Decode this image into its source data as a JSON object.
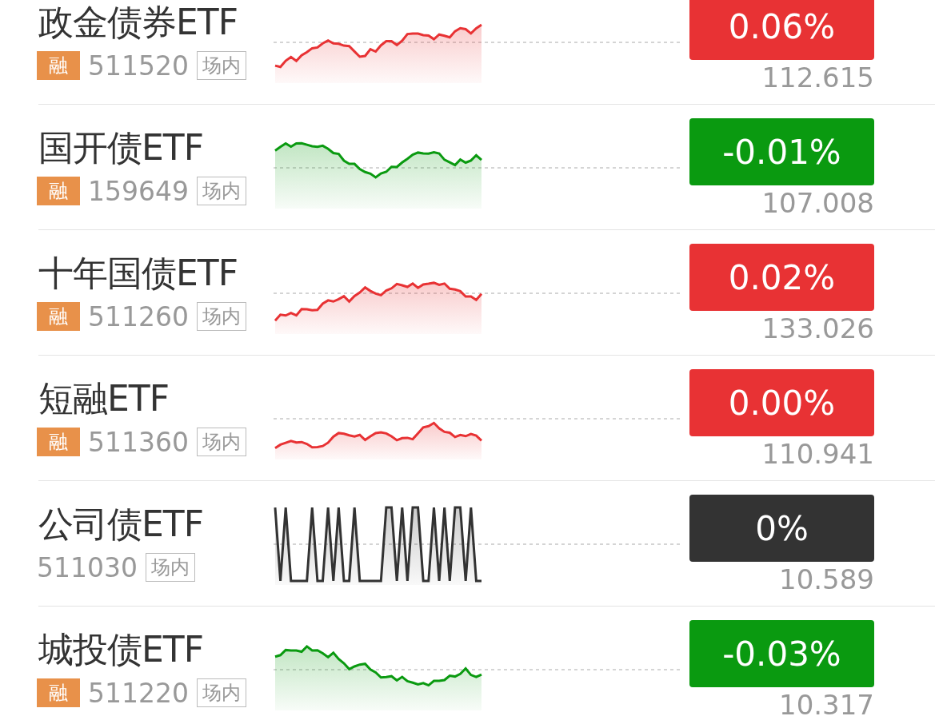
{
  "rows": [
    {
      "name": "政金债券ETF",
      "margin_tag": "融",
      "code": "511520",
      "market_tag": "场内",
      "change": "0.06%",
      "color": "#e83234",
      "price": "112.615"
    },
    {
      "name": "国开债ETF",
      "margin_tag": "融",
      "code": "159649",
      "market_tag": "场内",
      "change": "-0.01%",
      "color": "#0a9a10",
      "price": "107.008"
    },
    {
      "name": "十年国债ETF",
      "margin_tag": "融",
      "code": "511260",
      "market_tag": "场内",
      "change": "0.02%",
      "color": "#e83234",
      "price": "133.026"
    },
    {
      "name": "短融ETF",
      "margin_tag": "融",
      "code": "511360",
      "market_tag": "场内",
      "change": "0.00%",
      "color": "#e83234",
      "price": "110.941"
    },
    {
      "name": "公司债ETF",
      "code": "511030",
      "market_tag": "场内",
      "change": "0%",
      "color": "#333333",
      "price": "10.589"
    },
    {
      "name": "城投债ETF",
      "margin_tag": "融",
      "code": "511220",
      "market_tag": "场内",
      "change": "-0.03%",
      "color": "#0a9a10",
      "price": "10.317"
    }
  ]
}
